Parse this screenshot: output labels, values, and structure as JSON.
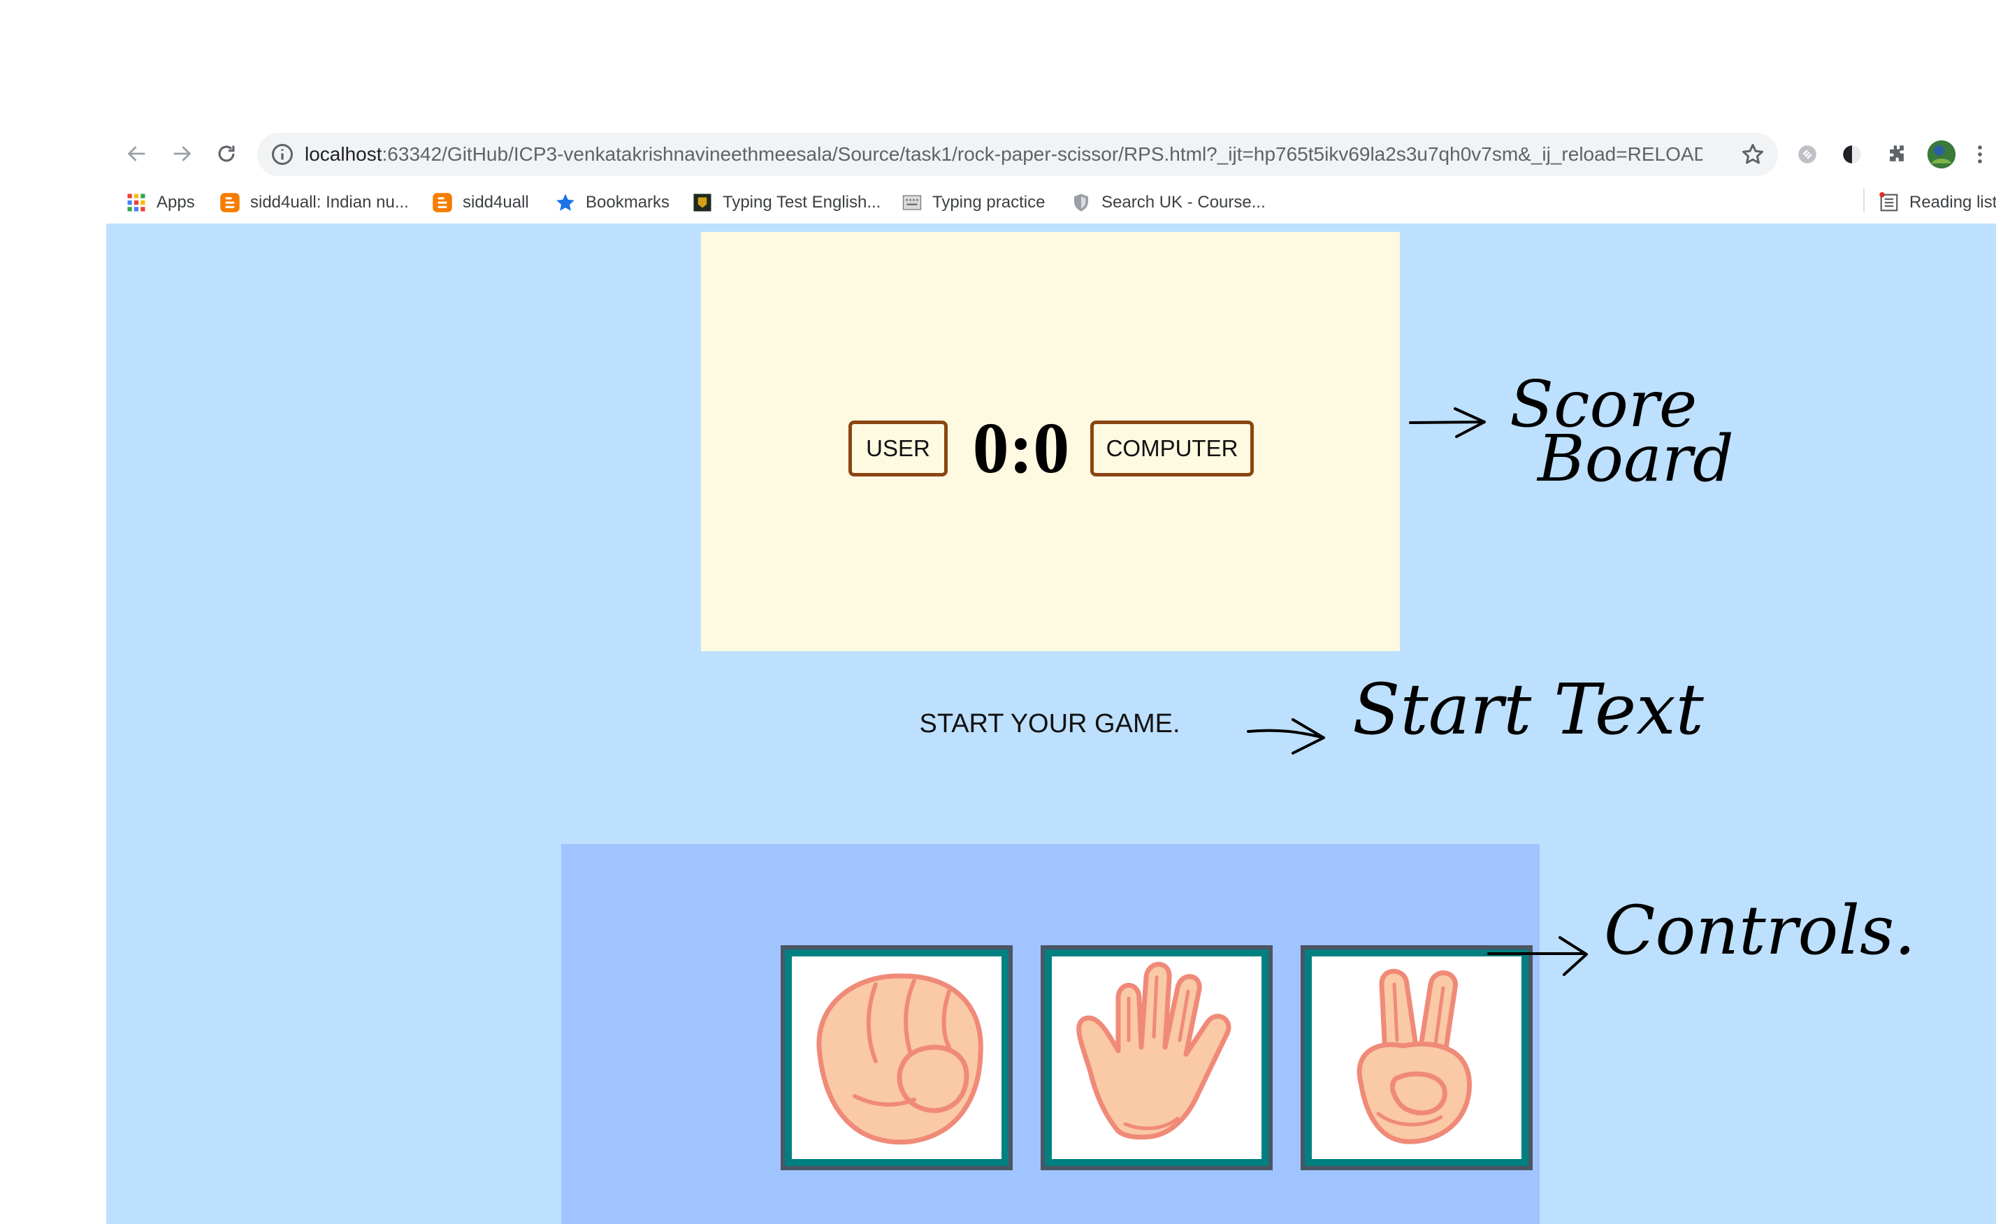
{
  "browser": {
    "url_host": "localhost",
    "url_path": ":63342/GitHub/ICP3-venkatakrishnavineethmeesala/Source/task1/rock-paper-scissor/RPS.html?_ijt=hp765t5ikv69la2s3u7qh0v7sm&_ij_reload=RELOAD_O..."
  },
  "bookmarks": {
    "apps": "Apps",
    "items": [
      {
        "label": "sidd4uall: Indian nu..."
      },
      {
        "label": "sidd4uall"
      },
      {
        "label": "Bookmarks"
      },
      {
        "label": "Typing Test English..."
      },
      {
        "label": "Typing practice"
      },
      {
        "label": "Search UK - Course..."
      }
    ],
    "reading_list": "Reading list"
  },
  "game": {
    "user_label": "USER",
    "score": "0:0",
    "computer_label": "COMPUTER",
    "start_text": "START YOUR GAME.",
    "choices": [
      {
        "name": "rock"
      },
      {
        "name": "paper"
      },
      {
        "name": "scissors"
      }
    ]
  },
  "annotations": {
    "scoreboard_line1": "Score",
    "scoreboard_line2": "Board",
    "start_text": "Start Text",
    "controls": "Controls."
  },
  "colors": {
    "page_bg": "#bde0fe",
    "scoreboard_bg": "#fef9e1",
    "label_border": "#8b4513",
    "controls_bg": "#a0c4ff",
    "choice_border": "#008080"
  }
}
